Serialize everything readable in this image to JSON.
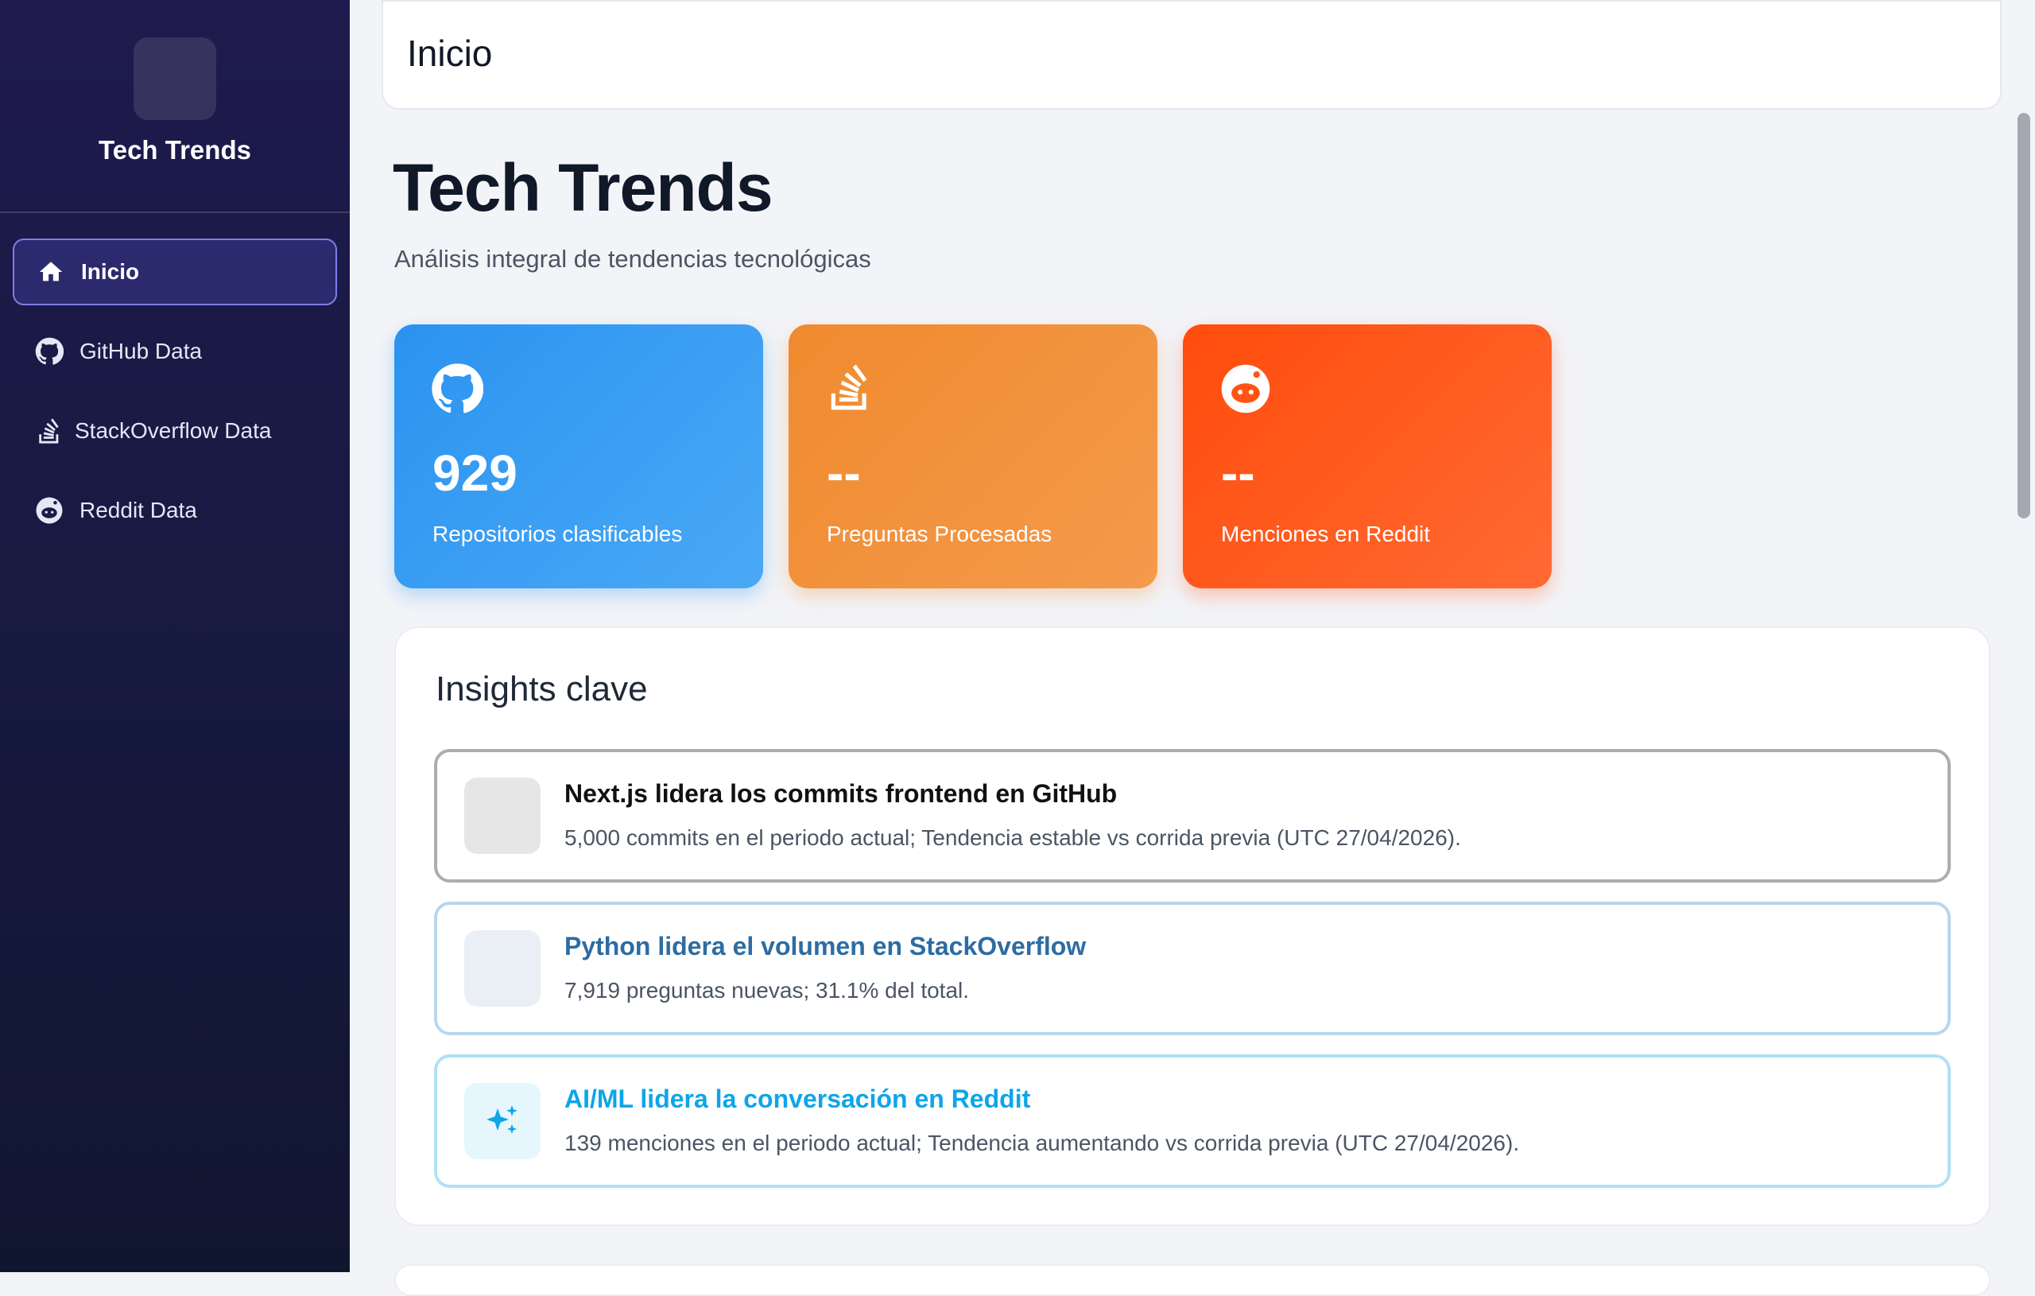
{
  "sidebar": {
    "brand": "Tech Trends",
    "items": [
      {
        "label": "Inicio",
        "icon": "home-icon",
        "active": true
      },
      {
        "label": "GitHub Data",
        "icon": "github-icon",
        "active": false
      },
      {
        "label": "StackOverflow Data",
        "icon": "stackoverflow-icon",
        "active": false
      },
      {
        "label": "Reddit Data",
        "icon": "reddit-icon",
        "active": false
      }
    ]
  },
  "topbar": {
    "title": "Inicio"
  },
  "page": {
    "title": "Tech Trends",
    "subtitle": "Análisis integral de tendencias tecnológicas"
  },
  "stats": [
    {
      "value": "929",
      "label": "Repositorios clasificables",
      "icon": "github-icon",
      "color": "#2b93f0"
    },
    {
      "value": "--",
      "label": "Preguntas Procesadas",
      "icon": "stackoverflow-icon",
      "color": "#f08a2e"
    },
    {
      "value": "--",
      "label": "Menciones en Reddit",
      "icon": "reddit-icon",
      "color": "#ff4c0c"
    }
  ],
  "insights": {
    "title": "Insights clave",
    "items": [
      {
        "title": "Next.js lidera los commits frontend en GitHub",
        "desc": "5,000 commits en el periodo actual; Tendencia estable vs corrida previa (UTC 27/04/2026).",
        "color": "#111111"
      },
      {
        "title": "Python lidera el volumen en StackOverflow",
        "desc": "7,919 preguntas nuevas; 31.1% del total.",
        "color": "#2d6ca2"
      },
      {
        "title": "AI/ML lidera la conversación en Reddit",
        "desc": "139 menciones en el periodo actual; Tendencia aumentando vs corrida previa (UTC 27/04/2026).",
        "icon": "sparkles-icon",
        "color": "#0ea5e9"
      }
    ]
  }
}
